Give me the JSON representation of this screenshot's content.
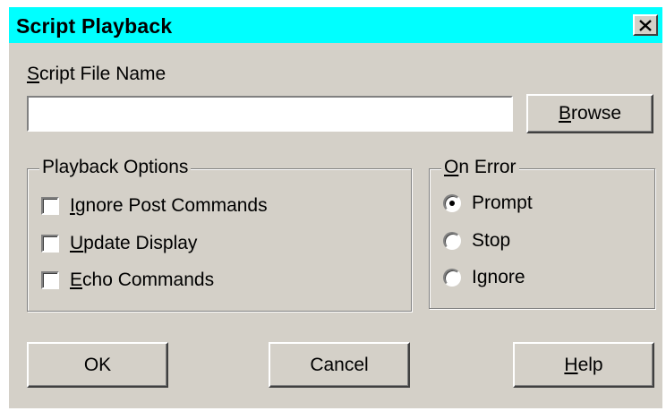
{
  "window": {
    "title": "Script Playback",
    "titlebar_color": "#00ffff",
    "background_color": "#d4d0c8",
    "close_icon": "close-icon"
  },
  "file": {
    "label_mnemonic": "S",
    "label_rest": "cript File Name",
    "value": "",
    "browse_mnemonic": "B",
    "browse_rest": "rowse"
  },
  "playback_options": {
    "title": "Playback Options",
    "items": [
      {
        "mnemonic": "I",
        "rest": "gnore Post Commands",
        "checked": false
      },
      {
        "mnemonic": "U",
        "rest": "pdate Display",
        "checked": false
      },
      {
        "mnemonic": "E",
        "rest": "cho Commands",
        "checked": false
      }
    ]
  },
  "on_error": {
    "title_before": "",
    "title_mnemonic": "O",
    "title_rest": "n Error",
    "options": [
      {
        "label": "Prompt",
        "selected": true
      },
      {
        "label": "Stop",
        "selected": false
      },
      {
        "label": "Ignore",
        "selected": false
      }
    ]
  },
  "buttons": {
    "ok": "OK",
    "cancel": "Cancel",
    "help_mnemonic": "H",
    "help_rest": "elp"
  }
}
